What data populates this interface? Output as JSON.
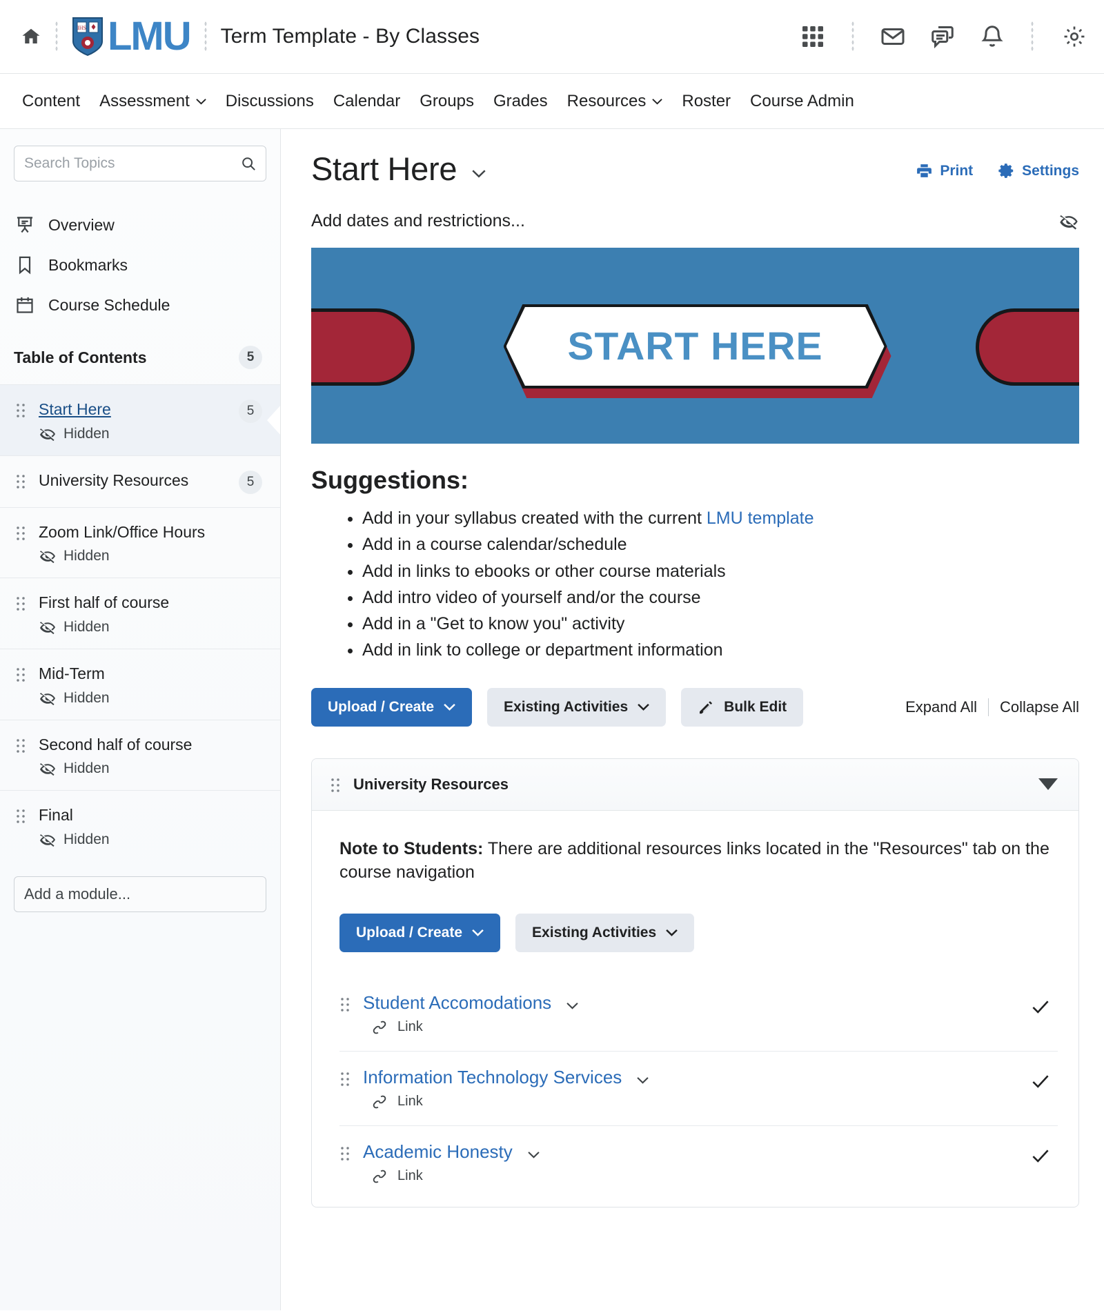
{
  "header": {
    "home_icon": "home-icon",
    "logo_text": "LMU",
    "course_title": "Term Template - By Classes",
    "tools": [
      {
        "name": "waffle-grid-icon",
        "label": "Course Selector"
      },
      {
        "name": "envelope-icon",
        "label": "Email"
      },
      {
        "name": "chat-bubbles-icon",
        "label": "Chat"
      },
      {
        "name": "bell-icon",
        "label": "Alerts"
      }
    ],
    "settings_icon": "gear-icon"
  },
  "nav": {
    "items": [
      {
        "label": "Content",
        "caret": false
      },
      {
        "label": "Assessment",
        "caret": true
      },
      {
        "label": "Discussions",
        "caret": false
      },
      {
        "label": "Calendar",
        "caret": false
      },
      {
        "label": "Groups",
        "caret": false
      },
      {
        "label": "Grades",
        "caret": false
      },
      {
        "label": "Resources",
        "caret": true
      },
      {
        "label": "Roster",
        "caret": false
      },
      {
        "label": "Course Admin",
        "caret": false
      }
    ]
  },
  "sidebar": {
    "search": {
      "placeholder": "Search Topics",
      "value": ""
    },
    "nav_items": [
      {
        "label": "Overview",
        "icon": "presentation-icon"
      },
      {
        "label": "Bookmarks",
        "icon": "bookmark-icon"
      },
      {
        "label": "Course Schedule",
        "icon": "calendar-icon"
      }
    ],
    "toc": {
      "title": "Table of Contents",
      "count": "5"
    },
    "modules": [
      {
        "label": "Start Here",
        "count": "5",
        "hidden": "Hidden",
        "active": true
      },
      {
        "label": "University Resources",
        "count": "5",
        "hidden": "",
        "active": false
      },
      {
        "label": "Zoom Link/Office Hours",
        "count": "",
        "hidden": "Hidden",
        "active": false
      },
      {
        "label": "First half of course",
        "count": "",
        "hidden": "Hidden",
        "active": false
      },
      {
        "label": "Mid-Term",
        "count": "",
        "hidden": "Hidden",
        "active": false
      },
      {
        "label": "Second half of course",
        "count": "",
        "hidden": "Hidden",
        "active": false
      },
      {
        "label": "Final",
        "count": "",
        "hidden": "Hidden",
        "active": false
      }
    ],
    "add_module": "Add a module..."
  },
  "main": {
    "page_title": "Start Here",
    "print_label": "Print",
    "settings_label": "Settings",
    "dates_text": "Add dates and restrictions...",
    "banner": {
      "text": "START HERE",
      "bg_color": "#3c7fb1",
      "accent_color": "#a32638",
      "text_color": "#4a90c4"
    },
    "suggestions_title": "Suggestions:",
    "suggestions": [
      {
        "text": "Add in your syllabus created with the current ",
        "link": "LMU template"
      },
      {
        "text": "Add in a course calendar/schedule",
        "link": ""
      },
      {
        "text": "Add in links to ebooks or other course materials",
        "link": ""
      },
      {
        "text": "Add intro video of yourself and/or the course",
        "link": ""
      },
      {
        "text": "Add in a \"Get to know you\" activity",
        "link": ""
      },
      {
        "text": "Add in link to college or department information",
        "link": ""
      }
    ],
    "toolbar": {
      "upload_create": "Upload / Create",
      "existing_activities": "Existing Activities",
      "bulk_edit": "Bulk Edit",
      "expand_all": "Expand All",
      "collapse_all": "Collapse All"
    },
    "module_card": {
      "title": "University Resources",
      "note_bold": "Note to Students:",
      "note_text": " There are additional resources links located in the \"Resources\" tab on the course navigation",
      "upload_create": "Upload / Create",
      "existing_activities": "Existing Activities",
      "items": [
        {
          "title": "Student Accomodations",
          "type": "Link"
        },
        {
          "title": "Information Technology Services",
          "type": "Link"
        },
        {
          "title": "Academic Honesty",
          "type": "Link"
        }
      ]
    }
  },
  "colors": {
    "brand_blue": "#3d85c6",
    "action_blue": "#2b6cb8",
    "banner_red": "#a32638"
  }
}
